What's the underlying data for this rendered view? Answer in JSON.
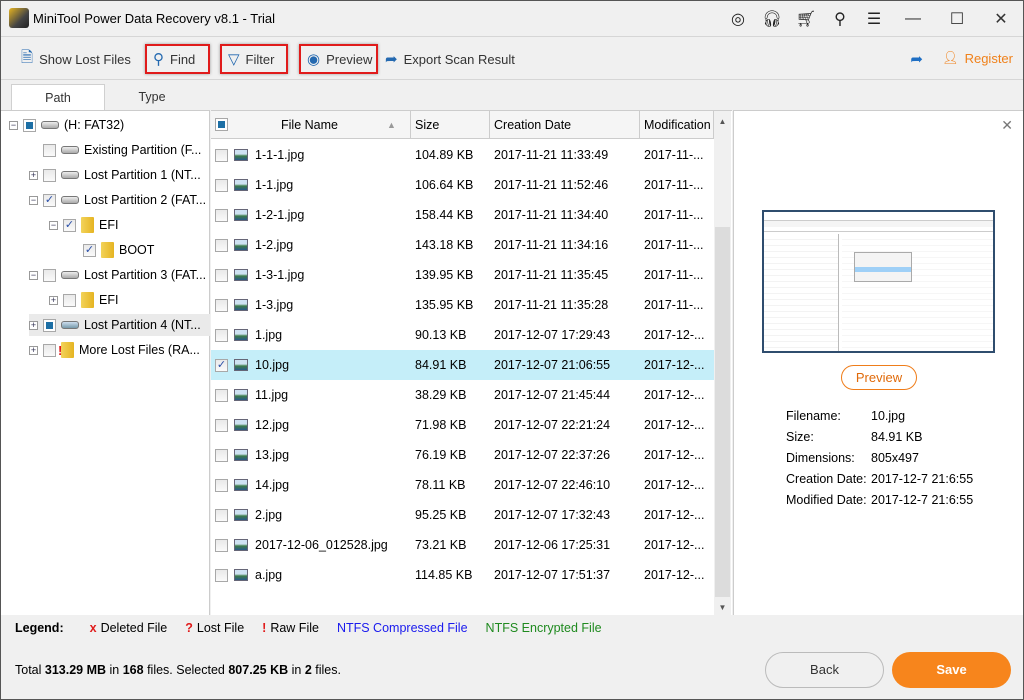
{
  "window": {
    "title": "MiniTool Power Data Recovery v8.1 - Trial"
  },
  "toolbar": {
    "show_lost_files": "Show Lost Files",
    "find": "Find",
    "filter": "Filter",
    "preview": "Preview",
    "export": "Export Scan Result",
    "register": "Register"
  },
  "tabs": [
    {
      "label": "Path"
    },
    {
      "label": "Type"
    }
  ],
  "tree": [
    {
      "label": "(H: FAT32)",
      "state": "partial",
      "icon": "drive",
      "expander": "-"
    },
    {
      "label": "Existing Partition (F...",
      "state": "unchecked",
      "icon": "drive",
      "expander": ""
    },
    {
      "label": "Lost Partition 1 (NT...",
      "state": "unchecked",
      "icon": "drive",
      "expander": "+"
    },
    {
      "label": "Lost Partition 2 (FAT...",
      "state": "checked",
      "icon": "drive",
      "expander": "-"
    },
    {
      "label": "EFI",
      "state": "checked",
      "icon": "folder",
      "expander": "-"
    },
    {
      "label": "BOOT",
      "state": "checked",
      "icon": "folder",
      "expander": ""
    },
    {
      "label": "Lost Partition 3 (FAT...",
      "state": "unchecked",
      "icon": "drive",
      "expander": "-"
    },
    {
      "label": "EFI",
      "state": "unchecked",
      "icon": "folder",
      "expander": "+"
    },
    {
      "label": "Lost Partition 4 (NT...",
      "state": "partial",
      "icon": "drive",
      "expander": "+"
    },
    {
      "label": "More Lost Files (RA...",
      "state": "unchecked",
      "icon": "folder-raw",
      "expander": "+"
    }
  ],
  "table": {
    "columns": [
      "File Name",
      "Size",
      "Creation Date",
      "Modification"
    ],
    "rows": [
      {
        "name": "1-1-1.jpg",
        "size": "104.89 KB",
        "created": "2017-11-21 11:33:49",
        "modified": "2017-11-...",
        "checked": false
      },
      {
        "name": "1-1.jpg",
        "size": "106.64 KB",
        "created": "2017-11-21 11:52:46",
        "modified": "2017-11-...",
        "checked": false
      },
      {
        "name": "1-2-1.jpg",
        "size": "158.44 KB",
        "created": "2017-11-21 11:34:40",
        "modified": "2017-11-...",
        "checked": false
      },
      {
        "name": "1-2.jpg",
        "size": "143.18 KB",
        "created": "2017-11-21 11:34:16",
        "modified": "2017-11-...",
        "checked": false
      },
      {
        "name": "1-3-1.jpg",
        "size": "139.95 KB",
        "created": "2017-11-21 11:35:45",
        "modified": "2017-11-...",
        "checked": false
      },
      {
        "name": "1-3.jpg",
        "size": "135.95 KB",
        "created": "2017-11-21 11:35:28",
        "modified": "2017-11-...",
        "checked": false
      },
      {
        "name": "1.jpg",
        "size": "90.13 KB",
        "created": "2017-12-07 17:29:43",
        "modified": "2017-12-...",
        "checked": false
      },
      {
        "name": "10.jpg",
        "size": "84.91 KB",
        "created": "2017-12-07 21:06:55",
        "modified": "2017-12-...",
        "checked": true
      },
      {
        "name": "11.jpg",
        "size": "38.29 KB",
        "created": "2017-12-07 21:45:44",
        "modified": "2017-12-...",
        "checked": false
      },
      {
        "name": "12.jpg",
        "size": "71.98 KB",
        "created": "2017-12-07 22:21:24",
        "modified": "2017-12-...",
        "checked": false
      },
      {
        "name": "13.jpg",
        "size": "76.19 KB",
        "created": "2017-12-07 22:37:26",
        "modified": "2017-12-...",
        "checked": false
      },
      {
        "name": "14.jpg",
        "size": "78.11 KB",
        "created": "2017-12-07 22:46:10",
        "modified": "2017-12-...",
        "checked": false
      },
      {
        "name": "2.jpg",
        "size": "95.25 KB",
        "created": "2017-12-07 17:32:43",
        "modified": "2017-12-...",
        "checked": false
      },
      {
        "name": "2017-12-06_012528.jpg",
        "size": "73.21 KB",
        "created": "2017-12-06 17:25:31",
        "modified": "2017-12-...",
        "checked": false
      },
      {
        "name": "a.jpg",
        "size": "114.85 KB",
        "created": "2017-12-07 17:51:37",
        "modified": "2017-12-...",
        "checked": false
      }
    ]
  },
  "preview": {
    "button": "Preview",
    "info": [
      {
        "label": "Filename:",
        "value": "10.jpg"
      },
      {
        "label": "Size:",
        "value": "84.91 KB"
      },
      {
        "label": "Dimensions:",
        "value": "805x497"
      },
      {
        "label": "Creation Date:",
        "value": "2017-12-7 21:6:55"
      },
      {
        "label": "Modified Date:",
        "value": "2017-12-7 21:6:55"
      }
    ]
  },
  "legend": {
    "title": "Legend:",
    "deleted": "Deleted File",
    "lost": "Lost File",
    "raw": "Raw File",
    "compressed": "NTFS Compressed File",
    "encrypted": "NTFS Encrypted File"
  },
  "status": {
    "total_prefix": "Total ",
    "total_size": "313.29 MB",
    "in1": " in ",
    "total_files": "168",
    "files1": " files.  Selected ",
    "selected_size": "807.25 KB",
    "in2": " in ",
    "selected_files": "2",
    "files2": " files."
  },
  "buttons": {
    "back": "Back",
    "save": "Save"
  }
}
